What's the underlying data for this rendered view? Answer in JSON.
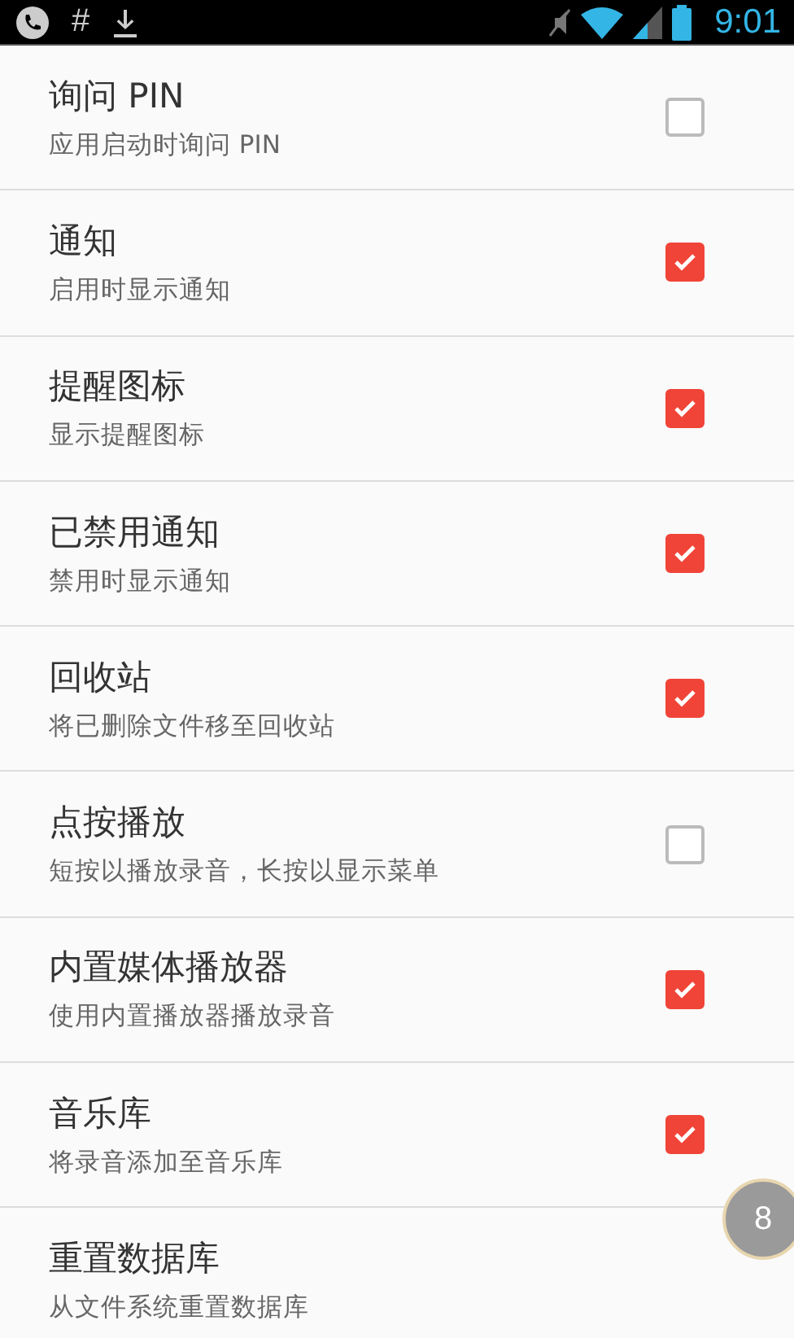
{
  "status_bar": {
    "notification_text": "#",
    "time": "9:01"
  },
  "settings": [
    {
      "title": "询问 PIN",
      "summary": "应用启动时询问 PIN",
      "checked": false
    },
    {
      "title": "通知",
      "summary": "启用时显示通知",
      "checked": true
    },
    {
      "title": "提醒图标",
      "summary": "显示提醒图标",
      "checked": true
    },
    {
      "title": "已禁用通知",
      "summary": "禁用时显示通知",
      "checked": true
    },
    {
      "title": "回收站",
      "summary": "将已删除文件移至回收站",
      "checked": true
    },
    {
      "title": "点按播放",
      "summary": "短按以播放录音，长按以显示菜单",
      "checked": false
    },
    {
      "title": "内置媒体播放器",
      "summary": "使用内置播放器播放录音",
      "checked": true
    },
    {
      "title": "音乐库",
      "summary": "将录音添加至音乐库",
      "checked": true
    },
    {
      "title": "重置数据库",
      "summary": "从文件系统重置数据库"
    }
  ],
  "floating_button": {
    "label": "8"
  }
}
